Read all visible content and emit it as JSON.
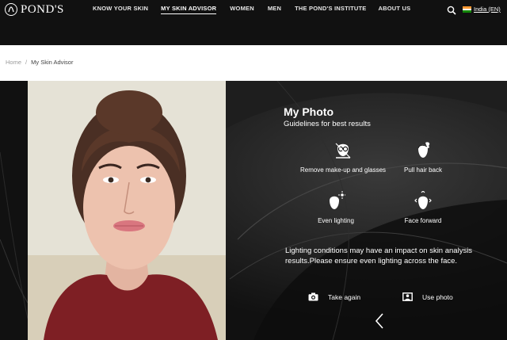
{
  "brand": {
    "name": "POND'S"
  },
  "nav": {
    "items": [
      {
        "label": "KNOW YOUR SKIN",
        "active": false
      },
      {
        "label": "MY SKIN ADVISOR",
        "active": true
      },
      {
        "label": "WOMEN",
        "active": false
      },
      {
        "label": "MEN",
        "active": false
      },
      {
        "label": "THE POND'S INSTITUTE",
        "active": false
      },
      {
        "label": "ABOUT US",
        "active": false
      }
    ],
    "search_icon": "search-icon",
    "locale": "India (EN)"
  },
  "breadcrumb": {
    "home": "Home",
    "separator": "/",
    "current": "My Skin Advisor"
  },
  "panel": {
    "title": "My Photo",
    "subtitle": "Guidelines for best results",
    "tips": [
      {
        "label": "Remove make-up and glasses",
        "icon": "no-makeup-glasses-icon"
      },
      {
        "label": "Pull hair back",
        "icon": "hair-back-icon"
      },
      {
        "label": "Even lighting",
        "icon": "even-lighting-icon"
      },
      {
        "label": "Face forward",
        "icon": "face-forward-icon"
      }
    ],
    "notice": "Lighting conditions may have an impact on skin analysis results.Please ensure even lighting across the face.",
    "actions": {
      "take_again": "Take again",
      "use_photo": "Use photo"
    }
  },
  "colors": {
    "nav_bg": "#111111",
    "stage_bg": "#151515",
    "text_light": "#ffffff",
    "breadcrumb": "#9a9a9a"
  }
}
